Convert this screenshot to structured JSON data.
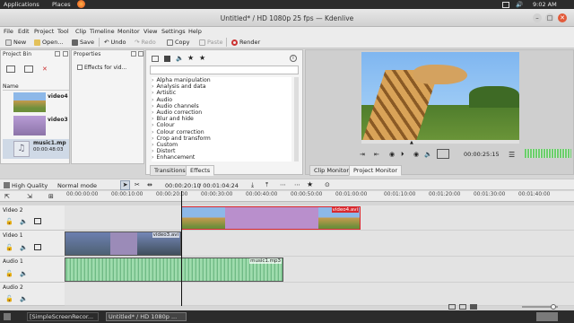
{
  "system_bar": {
    "applications": "Applications",
    "places": "Places",
    "clock": "9:02 AM"
  },
  "window": {
    "title": "Untitled* / HD 1080p 25 fps — Kdenlive"
  },
  "menu": [
    "File",
    "Edit",
    "Project",
    "Tool",
    "Clip",
    "Timeline",
    "Monitor",
    "View",
    "Settings",
    "Help"
  ],
  "toolbar": {
    "new": "New",
    "open": "Open...",
    "save": "Save",
    "undo": "Undo",
    "redo": "Redo",
    "copy": "Copy",
    "paste": "Paste",
    "render": "Render"
  },
  "project_bin": {
    "title": "Project Bin",
    "column_name": "Name",
    "items": [
      {
        "name": "video4",
        "extra": ""
      },
      {
        "name": "video3",
        "extra": ""
      },
      {
        "name": "music1.mp",
        "extra": "00:00:48:03"
      }
    ]
  },
  "properties": {
    "title": "Properties",
    "checkbox_label": "Effects for vid..."
  },
  "effects": {
    "list": [
      "Alpha manipulation",
      "Analysis and data",
      "Artistic",
      "Audio",
      "Audio channels",
      "Audio correction",
      "Blur and hide",
      "Colour",
      "Colour correction",
      "Crop and transform",
      "Custom",
      "Distort",
      "Enhancement"
    ],
    "tabs": {
      "transitions": "Transitions",
      "effects": "Effects"
    }
  },
  "monitor": {
    "timecode": "00:00:25:15",
    "tabs": {
      "clip": "Clip Monitor",
      "project": "Project Monitor"
    }
  },
  "timeline_toolbar": {
    "quality": "High Quality",
    "mode": "Normal mode",
    "position": "00:00:20:10",
    "duration": "00:01:04:24"
  },
  "ruler": [
    "00:00:00:00",
    "00:00:10:00",
    "00:00:20:00",
    "00:00:30:00",
    "00:00:40:00",
    "00:00:50:00",
    "00:01:00:00",
    "00:01:10:00",
    "00:01:20:00",
    "00:01:30:00",
    "00:01:40:00",
    "00:01:50:00"
  ],
  "tracks": [
    "Video 2",
    "Video 1",
    "Audio 1",
    "Audio 2"
  ],
  "clips": {
    "video4": "video4.avi",
    "video3": "video3.avi",
    "music": "music1.mp3"
  },
  "taskbar": {
    "item1": "[SimpleScreenRecor...",
    "item2": "Untitled* / HD 1080p ..."
  },
  "colors": {
    "video_clip": "#b98fcc",
    "audio_clip": "#8fd19e",
    "selected_border": "#d8282e",
    "playhead": "#111111"
  }
}
